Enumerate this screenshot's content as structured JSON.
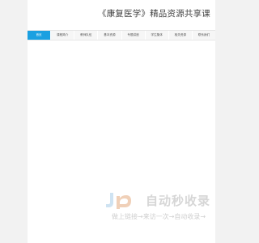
{
  "header": {
    "title": "《康复医学》精品资源共享课"
  },
  "nav": {
    "items": [
      {
        "label": "首页",
        "active": true
      },
      {
        "label": "课程简介",
        "active": false
      },
      {
        "label": "教师队伍",
        "active": false
      },
      {
        "label": "基本资源",
        "active": false
      },
      {
        "label": "专题讲座",
        "active": false
      },
      {
        "label": "学生集体",
        "active": false
      },
      {
        "label": "相关资源",
        "active": false
      },
      {
        "label": "联系我们",
        "active": false
      }
    ],
    "active_color": "#1ba0e1"
  },
  "watermark": {
    "brand": "自动秒收录",
    "tagline": "做上链接→来访一次→自动收录→",
    "logo_icon": "jp-logo-icon"
  }
}
